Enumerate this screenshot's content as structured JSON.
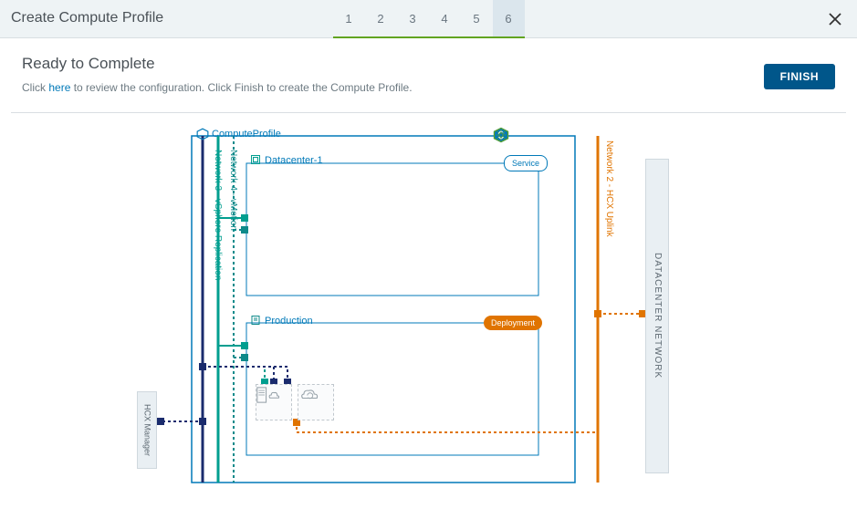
{
  "wizard": {
    "title": "Create Compute Profile",
    "steps": [
      "1",
      "2",
      "3",
      "4",
      "5",
      "6"
    ],
    "current_step_index": 5,
    "close_label": "Close"
  },
  "subheader": {
    "heading": "Ready to Complete",
    "pre_link_text": "Click ",
    "link_text": "here",
    "post_link_text": " to review the configuration. Click Finish to create the Compute Profile.",
    "finish_label": "Finish"
  },
  "diagram": {
    "profile_label": "ComputeProfile",
    "clusters": [
      {
        "name": "Datacenter-1",
        "badge": "Service"
      },
      {
        "name": "Production",
        "badge": "Deployment"
      }
    ],
    "networks": {
      "n2": "Network 2 - HCX Uplink",
      "n3": "Network 3 - vSphere Replication",
      "n4": "Network 4 - vMotion"
    },
    "hcx_manager": "HCX Manager",
    "dc_network": "DATACENTER NETWORK"
  },
  "colors": {
    "profile_border": "#0079b8",
    "service_box": "#0079b8",
    "teal": "#009e8f",
    "navy": "#1a2b6d",
    "orange": "#e07400"
  }
}
